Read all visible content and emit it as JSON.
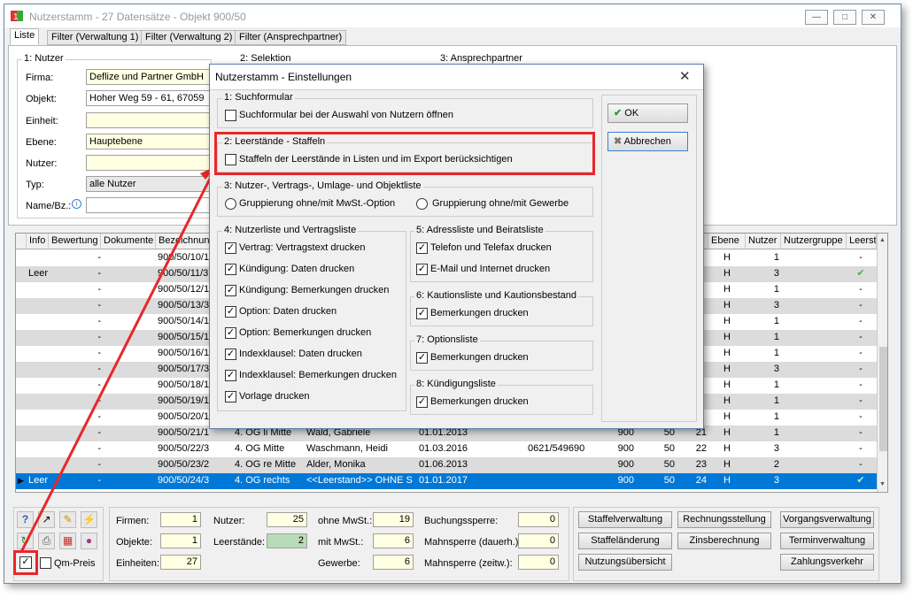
{
  "window": {
    "title": "Nutzerstamm - 27 Datensätze - Objekt 900/50"
  },
  "tabs": [
    "Liste",
    "Filter (Verwaltung 1)",
    "Filter (Verwaltung 2)",
    "Filter (Ansprechpartner)"
  ],
  "filter": {
    "group_title": "1: Nutzer",
    "section2": "2: Selektion",
    "section3": "3: Ansprechpartner",
    "firma_label": "Firma:",
    "firma": "Deflize und Partner GmbH",
    "objekt_label": "Objekt:",
    "objekt": "Hoher Weg 59 - 61, 67059",
    "einheit_label": "Einheit:",
    "ebene_label": "Ebene:",
    "ebene": "Hauptebene",
    "nutzer_label": "Nutzer:",
    "typ_label": "Typ:",
    "typ": "alle Nutzer",
    "name_label": "Name/Bz.:"
  },
  "grid": {
    "headers_left": [
      "Info",
      "Bewertung",
      "Dokumente",
      "Bezeichnung"
    ],
    "headers_right": [
      "Ebene",
      "Nutzer",
      "Nutzergruppe",
      "Leerst"
    ],
    "rows": [
      {
        "info": "",
        "bew": "-",
        "bez": "900/50/10/1",
        "lage": "",
        "name": "",
        "beginn": "",
        "tel": "",
        "a": "",
        "b": "",
        "c": "",
        "ebene": "H",
        "nutzer": "1",
        "gruppe": "",
        "leer": "-"
      },
      {
        "info": "Leer",
        "bew": "-",
        "bez": "900/50/11/3",
        "lage": "",
        "name": "",
        "beginn": "",
        "tel": "",
        "a": "",
        "b": "",
        "c": "",
        "ebene": "H",
        "nutzer": "3",
        "gruppe": "",
        "leer": "✔"
      },
      {
        "info": "",
        "bew": "-",
        "bez": "900/50/12/1",
        "lage": "",
        "name": "",
        "beginn": "",
        "tel": "",
        "a": "",
        "b": "",
        "c": "",
        "ebene": "H",
        "nutzer": "1",
        "gruppe": "",
        "leer": "-"
      },
      {
        "info": "",
        "bew": "-",
        "bez": "900/50/13/3",
        "lage": "",
        "name": "",
        "beginn": "",
        "tel": "",
        "a": "",
        "b": "",
        "c": "",
        "ebene": "H",
        "nutzer": "3",
        "gruppe": "",
        "leer": "-"
      },
      {
        "info": "",
        "bew": "-",
        "bez": "900/50/14/1",
        "lage": "",
        "name": "",
        "beginn": "",
        "tel": "",
        "a": "",
        "b": "",
        "c": "",
        "ebene": "H",
        "nutzer": "1",
        "gruppe": "",
        "leer": "-"
      },
      {
        "info": "",
        "bew": "-",
        "bez": "900/50/15/1",
        "lage": "",
        "name": "",
        "beginn": "",
        "tel": "",
        "a": "",
        "b": "",
        "c": "",
        "ebene": "H",
        "nutzer": "1",
        "gruppe": "",
        "leer": "-"
      },
      {
        "info": "",
        "bew": "-",
        "bez": "900/50/16/1",
        "lage": "",
        "name": "",
        "beginn": "",
        "tel": "",
        "a": "",
        "b": "",
        "c": "",
        "ebene": "H",
        "nutzer": "1",
        "gruppe": "",
        "leer": "-"
      },
      {
        "info": "",
        "bew": "-",
        "bez": "900/50/17/3",
        "lage": "",
        "name": "",
        "beginn": "",
        "tel": "",
        "a": "",
        "b": "",
        "c": "",
        "ebene": "H",
        "nutzer": "3",
        "gruppe": "",
        "leer": "-"
      },
      {
        "info": "",
        "bew": "-",
        "bez": "900/50/18/1",
        "lage": "",
        "name": "",
        "beginn": "",
        "tel": "",
        "a": "",
        "b": "",
        "c": "",
        "ebene": "H",
        "nutzer": "1",
        "gruppe": "",
        "leer": "-"
      },
      {
        "info": "",
        "bew": "-",
        "bez": "900/50/19/1",
        "lage": "",
        "name": "",
        "beginn": "",
        "tel": "",
        "a": "",
        "b": "",
        "c": "",
        "ebene": "H",
        "nutzer": "1",
        "gruppe": "",
        "leer": "-"
      },
      {
        "info": "",
        "bew": "-",
        "bez": "900/50/20/1",
        "lage": "",
        "name": "",
        "beginn": "",
        "tel": "",
        "a": "",
        "b": "",
        "c": "",
        "ebene": "H",
        "nutzer": "1",
        "gruppe": "",
        "leer": "-"
      },
      {
        "info": "",
        "bew": "-",
        "bez": "900/50/21/1",
        "lage": "4. OG li Mitte",
        "name": "Wald, Gabriele",
        "beginn": "01.01.2013",
        "tel": "",
        "a": "900",
        "b": "50",
        "c": "21",
        "ebene": "H",
        "nutzer": "1",
        "gruppe": "",
        "leer": "-"
      },
      {
        "info": "",
        "bew": "-",
        "bez": "900/50/22/3",
        "lage": "4. OG Mitte",
        "name": "Waschmann, Heidi",
        "beginn": "01.03.2016",
        "tel": "0621/549690",
        "a": "900",
        "b": "50",
        "c": "22",
        "ebene": "H",
        "nutzer": "3",
        "gruppe": "",
        "leer": "-"
      },
      {
        "info": "",
        "bew": "-",
        "bez": "900/50/23/2",
        "lage": "4. OG re Mitte",
        "name": "Alder, Monika",
        "beginn": "01.06.2013",
        "tel": "",
        "a": "900",
        "b": "50",
        "c": "23",
        "ebene": "H",
        "nutzer": "2",
        "gruppe": "",
        "leer": "-"
      },
      {
        "info": "Leer",
        "bew": "-",
        "bez": "900/50/24/3",
        "lage": "4. OG rechts",
        "name": "<<Leerstand>> OHNE SI",
        "beginn": "01.01.2017",
        "tel": "",
        "a": "900",
        "b": "50",
        "c": "24",
        "ebene": "H",
        "nutzer": "3",
        "gruppe": "",
        "leer": "✔"
      }
    ]
  },
  "stats": {
    "firmen_label": "Firmen:",
    "firmen": "1",
    "objekte_label": "Objekte:",
    "objekte": "1",
    "einheiten_label": "Einheiten:",
    "einheiten": "27",
    "nutzer_label": "Nutzer:",
    "nutzer": "25",
    "leerstaende_label": "Leerstände:",
    "leerstaende": "2",
    "ohne_mwst_label": "ohne MwSt.:",
    "ohne_mwst": "19",
    "mit_mwst_label": "mit MwSt.:",
    "mit_mwst": "6",
    "gewerbe_label": "Gewerbe:",
    "gewerbe": "6",
    "buchungssperre_label": "Buchungssperre:",
    "buchungssperre": "0",
    "mahnsperre_dauer_label": "Mahnsperre (dauerh.):",
    "mahnsperre_dauer": "0",
    "mahnsperre_zeitw_label": "Mahnsperre (zeitw.):",
    "mahnsperre_zeitw": "0",
    "qm_preis_label": "Qm-Preis"
  },
  "buttons": {
    "staffelverwaltung": "Staffelverwaltung",
    "rechnungsstellung": "Rechnungsstellung",
    "vorgangsverwaltung": "Vorgangsverwaltung",
    "staffelaenderung": "Staffeländerung",
    "zinsberechnung": "Zinsberechnung",
    "terminverwaltung": "Terminverwaltung",
    "nutzungsuebersicht": "Nutzungsübersicht",
    "zahlungsverkehr": "Zahlungsverkehr"
  },
  "dialog": {
    "title": "Nutzerstamm - Einstellungen",
    "ok": "OK",
    "cancel": "Abbrechen",
    "g1": "1: Suchformular",
    "g1_opt": "Suchformular bei der Auswahl von Nutzern öffnen",
    "g2": "2: Leerstände - Staffeln",
    "g2_opt": "Staffeln der Leerstände in Listen und im Export berücksichtigen",
    "g3": "3: Nutzer-, Vertrags-, Umlage- und Objektliste",
    "g3_r1": "Gruppierung ohne/mit MwSt.-Option",
    "g3_r2": "Gruppierung ohne/mit Gewerbe",
    "g4": "4: Nutzerliste und Vertragsliste",
    "g4_opts": [
      "Vertrag: Vertragstext drucken",
      "Kündigung: Daten drucken",
      "Kündigung: Bemerkungen drucken",
      "Option: Daten drucken",
      "Option: Bemerkungen drucken",
      "Indexklausel: Daten drucken",
      "Indexklausel: Bemerkungen drucken",
      "Vorlage drucken"
    ],
    "g5": "5: Adressliste und Beiratsliste",
    "g5_opts": [
      "Telefon und Telefax drucken",
      "E-Mail und Internet drucken"
    ],
    "g6": "6: Kautionsliste und Kautionsbestand",
    "g6_opt": "Bemerkungen drucken",
    "g7": "7: Optionsliste",
    "g7_opt": "Bemerkungen drucken",
    "g8": "8: Kündigungsliste",
    "g8_opt": "Bemerkungen drucken"
  },
  "colors": {
    "accent": "#e8272a",
    "selection": "#0078d7",
    "field": "#ffffe1"
  }
}
